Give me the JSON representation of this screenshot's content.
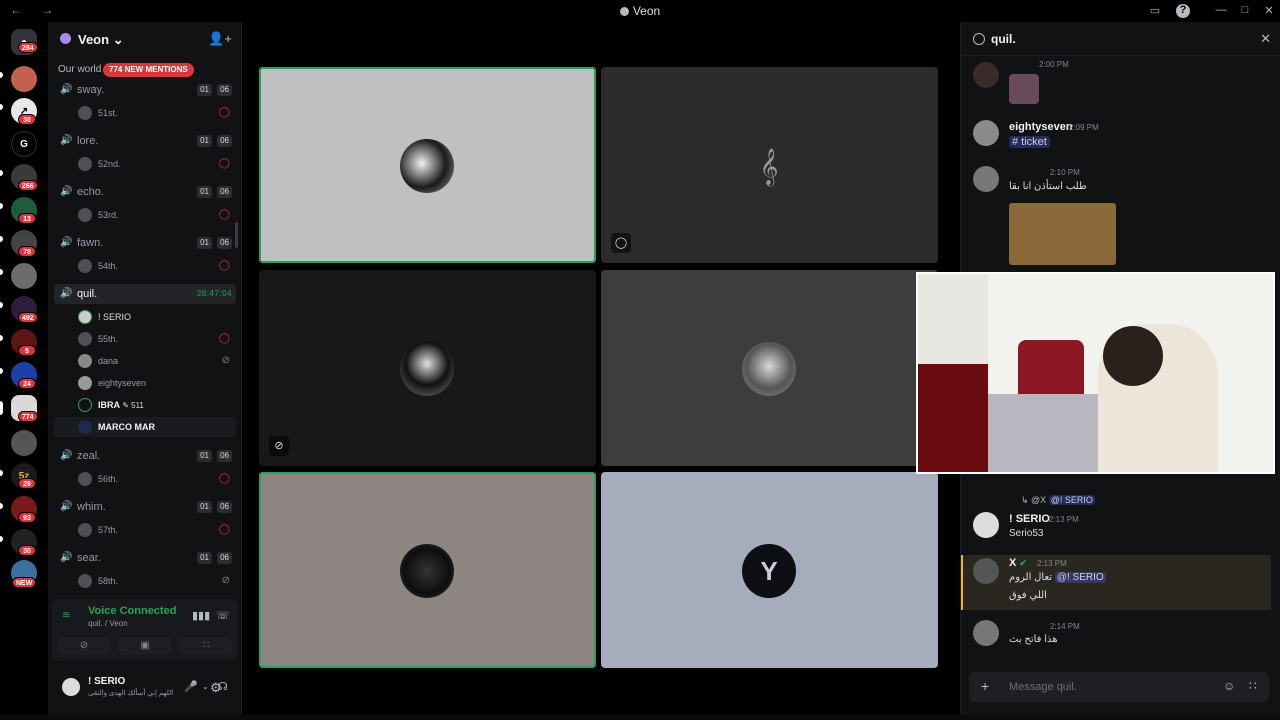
{
  "window": {
    "title": "Veon"
  },
  "rail": {
    "servers": [
      {
        "icon": "discord-home-icon",
        "badge": "284"
      },
      {
        "icon": "server-icon",
        "badge": ""
      },
      {
        "icon": "server-icon",
        "badge": "30"
      },
      {
        "icon": "server-icon",
        "label": "G",
        "badge": ""
      },
      {
        "icon": "server-icon",
        "badge": "266"
      },
      {
        "icon": "server-icon",
        "badge": "13"
      },
      {
        "icon": "server-icon",
        "badge": "78"
      },
      {
        "icon": "server-icon",
        "badge": ""
      },
      {
        "icon": "server-icon",
        "badge": "492"
      },
      {
        "icon": "server-icon",
        "badge": "5"
      },
      {
        "icon": "server-icon",
        "badge": "24"
      },
      {
        "icon": "server-icon",
        "badge": "774"
      },
      {
        "icon": "server-icon",
        "badge": ""
      },
      {
        "icon": "server-icon",
        "badge": "29"
      },
      {
        "icon": "server-icon",
        "badge": "93"
      },
      {
        "icon": "server-icon",
        "badge": "30"
      },
      {
        "icon": "server-icon",
        "badge": "NEW"
      }
    ]
  },
  "sidebar": {
    "server_name": "Veon",
    "world_label": "Our world",
    "mentions_badge": "774 NEW MENTIONS",
    "channels": [
      {
        "name": "sway.",
        "count_a": "01",
        "count_b": "06",
        "user": "51st."
      },
      {
        "name": "lore.",
        "count_a": "01",
        "count_b": "06",
        "user": "52nd."
      },
      {
        "name": "echo.",
        "count_a": "01",
        "count_b": "06",
        "user": "53rd."
      },
      {
        "name": "fawn.",
        "count_a": "01",
        "count_b": "06",
        "user": "54th."
      },
      {
        "name": "zeal.",
        "count_a": "01",
        "count_b": "06",
        "user": "56th."
      },
      {
        "name": "whim.",
        "count_a": "01",
        "count_b": "06",
        "user": "57th."
      },
      {
        "name": "sear.",
        "count_a": "01",
        "count_b": "06",
        "user": "58th."
      }
    ],
    "active_channel": {
      "name": "quil.",
      "timer": "28:47:04",
      "users": [
        "! SERIO",
        "55th.",
        "dana",
        "eightyseven",
        "IBRA",
        "MARCO MAR"
      ],
      "ibra_tag": "511"
    },
    "voice": {
      "status": "Voice Connected",
      "location": "quil. / Veon"
    },
    "me": {
      "name": "! SERIO",
      "status": "اللهم إني أسألك الهدى والتقى"
    }
  },
  "chat": {
    "title": "quil.",
    "messages": [
      {
        "author": "",
        "time": "2:00 PM",
        "text": ""
      },
      {
        "author": "eightyseven",
        "time": "2:09 PM",
        "text": "# ticket"
      },
      {
        "author": "",
        "time": "2:10 PM",
        "text": "طلب استأذن انا بقا"
      },
      {
        "reply_from": "@X",
        "reply_to": "@! SERIO"
      },
      {
        "author": "! SERIO",
        "time": "2:13 PM",
        "text": "Serio53"
      },
      {
        "author": "X",
        "time": "2:13 PM",
        "text": "تعال الروم",
        "mention": "@! SERIO",
        "text2": "اللي فوق"
      },
      {
        "author": "",
        "time": "2:14 PM",
        "text": "هذا فاتح بث"
      }
    ],
    "input_placeholder": "Message quil."
  },
  "colors": {
    "accent_green": "#23a559",
    "danger": "#da373c",
    "brand": "#5865f2"
  }
}
